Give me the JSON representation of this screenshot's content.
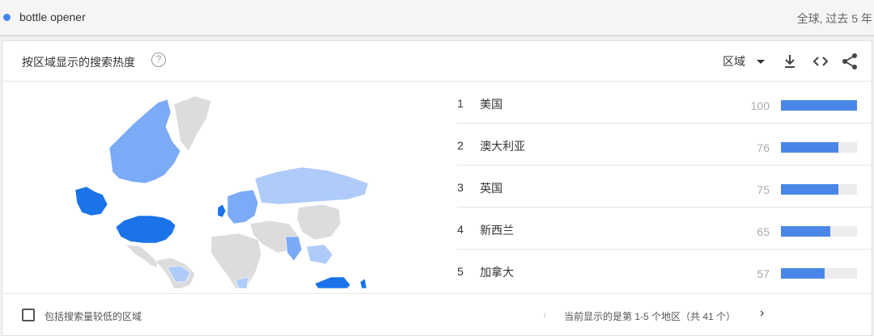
{
  "search": {
    "term": "bottle opener",
    "scope": "全球, 过去 5 年"
  },
  "card": {
    "title": "按区域显示的搜索热度",
    "help_icon": "?",
    "region_select": "区域",
    "icons": [
      "download-icon",
      "embed-icon",
      "share-icon"
    ]
  },
  "colors": {
    "accent": "#4285f4",
    "bar": "#4a86e8",
    "map_high": "#1a73e8",
    "map_mid": "#7baaf7",
    "map_low": "#aecbfa",
    "map_none": "#dcdcdc"
  },
  "regions": [
    {
      "rank": "1",
      "name": "美国",
      "value": "100",
      "fraction": 1.0
    },
    {
      "rank": "2",
      "name": "澳大利亚",
      "value": "76",
      "fraction": 0.76
    },
    {
      "rank": "3",
      "name": "英国",
      "value": "75",
      "fraction": 0.75
    },
    {
      "rank": "4",
      "name": "新西兰",
      "value": "65",
      "fraction": 0.65
    },
    {
      "rank": "5",
      "name": "加拿大",
      "value": "57",
      "fraction": 0.57
    }
  ],
  "footer": {
    "checkbox_label": "包括搜索量较低的区域",
    "page_info": "当前显示的是第 1-5 个地区（共 41 个）"
  }
}
